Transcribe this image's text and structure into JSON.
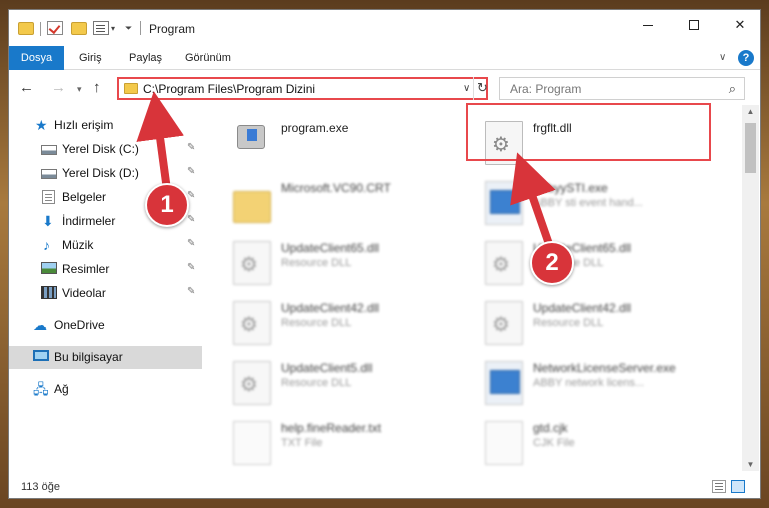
{
  "window": {
    "title": "Program",
    "controls": {
      "minimize": "",
      "maximize": "",
      "close": "✕"
    }
  },
  "ribbon": {
    "tabs": [
      {
        "label": "Dosya",
        "active": true
      },
      {
        "label": "Giriş"
      },
      {
        "label": "Paylaş"
      },
      {
        "label": "Görünüm"
      }
    ],
    "help": "?"
  },
  "navbar": {
    "address": "C:\\Program Files\\Program Dizini",
    "search_placeholder": "Ara: Program"
  },
  "sidebar": {
    "items": [
      {
        "label": "Hızlı erişim",
        "icon": "star-icon"
      },
      {
        "label": "Yerel Disk (C:)",
        "icon": "disk-icon",
        "pinned": true
      },
      {
        "label": "Yerel Disk (D:)",
        "icon": "disk-icon",
        "pinned": true
      },
      {
        "label": "Belgeler",
        "icon": "documents-icon",
        "pinned": true
      },
      {
        "label": "İndirmeler",
        "icon": "download-icon",
        "pinned": true
      },
      {
        "label": "Müzik",
        "icon": "music-icon",
        "pinned": true
      },
      {
        "label": "Resimler",
        "icon": "pictures-icon",
        "pinned": true
      },
      {
        "label": "Videolar",
        "icon": "videos-icon",
        "pinned": true
      },
      {
        "label": "OneDrive",
        "icon": "cloud-icon"
      },
      {
        "label": "Bu bilgisayar",
        "icon": "computer-icon",
        "selected": true
      },
      {
        "label": "Ağ",
        "icon": "network-icon"
      }
    ]
  },
  "files": [
    {
      "name": "program.exe",
      "type": "",
      "icon": "program-icon"
    },
    {
      "name": "frgflt.dll",
      "type": "",
      "icon": "dll-icon",
      "highlighted": true
    },
    {
      "name": "Microsoft.VC90.CRT",
      "type": "",
      "icon": "folder-icon"
    },
    {
      "name": "AbbyySTI.exe",
      "type": "ABBY sti event hand...",
      "icon": "exe-icon"
    },
    {
      "name": "UpdateClient65.dll",
      "type": "Resource DLL",
      "icon": "dll-icon"
    },
    {
      "name": "UpdateClient65.dll",
      "type": "Resource DLL",
      "icon": "dll-icon"
    },
    {
      "name": "UpdateClient42.dll",
      "type": "Resource DLL",
      "icon": "dll-icon"
    },
    {
      "name": "UpdateClient42.dll",
      "type": "Resource DLL",
      "icon": "dll-icon"
    },
    {
      "name": "UpdateClient5.dll",
      "type": "Resource DLL",
      "icon": "dll-icon"
    },
    {
      "name": "NetworkLicenseServer.exe",
      "type": "ABBY network licens...",
      "icon": "exe-icon"
    },
    {
      "name": "help.fineReader.txt",
      "type": "TXT File",
      "icon": "txt-icon"
    },
    {
      "name": "gtd.cjk",
      "type": "CJK File",
      "icon": "txt-icon"
    }
  ],
  "status": {
    "count": "113 öğe"
  },
  "annotations": {
    "badge1": "1",
    "badge2": "2",
    "color": "#d8343a"
  },
  "glyphs": {
    "back": "←",
    "forward": "→",
    "up": "↑",
    "chevron": "⌄",
    "refresh": "↻",
    "search": "⚲",
    "pin": "📌"
  }
}
